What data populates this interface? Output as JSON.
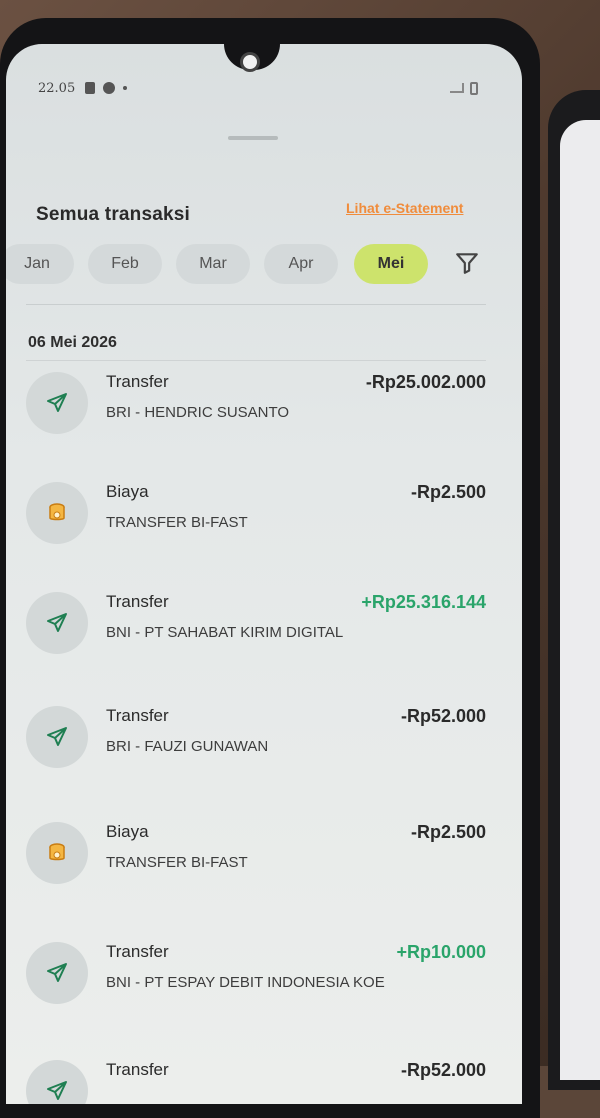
{
  "status_bar": {
    "time": "22.05"
  },
  "header": {
    "title": "Semua transaksi",
    "estatement_link": "Lihat e-Statement"
  },
  "months": [
    {
      "label": "Jan",
      "active": false
    },
    {
      "label": "Feb",
      "active": false
    },
    {
      "label": "Mar",
      "active": false
    },
    {
      "label": "Apr",
      "active": false
    },
    {
      "label": "Mei",
      "active": true
    }
  ],
  "date_header": "06 Mei 2026",
  "transactions": [
    {
      "type": "Transfer",
      "description": "BRI - HENDRIC SUSANTO",
      "amount": "-Rp25.002.000",
      "direction": "out",
      "icon": "paper-plane-icon"
    },
    {
      "type": "Biaya",
      "description": "TRANSFER BI-FAST",
      "amount": "-Rp2.500",
      "direction": "out",
      "icon": "coin-stack-icon"
    },
    {
      "type": "Transfer",
      "description": "BNI - PT SAHABAT KIRIM DIGITAL",
      "amount": "+Rp25.316.144",
      "direction": "in",
      "icon": "paper-plane-icon"
    },
    {
      "type": "Transfer",
      "description": "BRI - FAUZI GUNAWAN",
      "amount": "-Rp52.000",
      "direction": "out",
      "icon": "paper-plane-icon"
    },
    {
      "type": "Biaya",
      "description": "TRANSFER BI-FAST",
      "amount": "-Rp2.500",
      "direction": "out",
      "icon": "coin-stack-icon"
    },
    {
      "type": "Transfer",
      "description": "BNI - PT ESPAY DEBIT INDONESIA KOE",
      "amount": "+Rp10.000",
      "direction": "in",
      "icon": "paper-plane-icon"
    },
    {
      "type": "Transfer",
      "description": "",
      "amount": "-Rp52.000",
      "direction": "out",
      "icon": "paper-plane-icon"
    }
  ],
  "colors": {
    "accent_chip": "#cde36c",
    "positive_amount": "#2aa46a",
    "estatement_link": "#f08c3c"
  }
}
